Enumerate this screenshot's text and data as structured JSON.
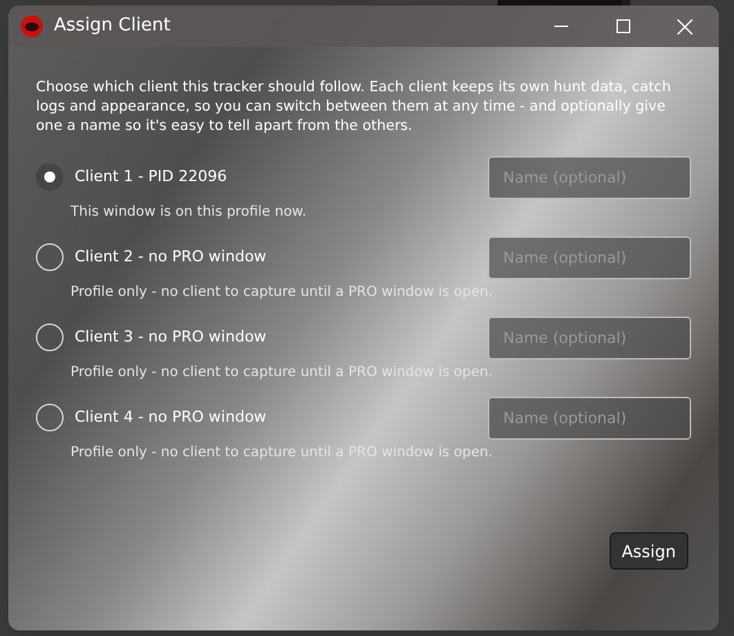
{
  "window": {
    "title": "Assign Client"
  },
  "description": "Choose which client this tracker should follow. Each client keeps its own hunt data, catch logs and appearance, so you can switch between them at any time - and optionally give one a name so it's easy to tell apart from the others.",
  "clients": [
    {
      "label": "Client 1 - PID 22096",
      "note": "This window is on this profile now.",
      "placeholder": "Name (optional)",
      "selected": true
    },
    {
      "label": "Client 2 - no PRO window",
      "note": "Profile only - no client to capture until a PRO window is open.",
      "placeholder": "Name (optional)",
      "selected": false
    },
    {
      "label": "Client 3 - no PRO window",
      "note": "Profile only - no client to capture until a PRO window is open.",
      "placeholder": "Name (optional)",
      "selected": false
    },
    {
      "label": "Client 4 - no PRO window",
      "note": "Profile only - no client to capture until a PRO window is open.",
      "placeholder": "Name (optional)",
      "selected": false
    }
  ],
  "button": "Assign"
}
